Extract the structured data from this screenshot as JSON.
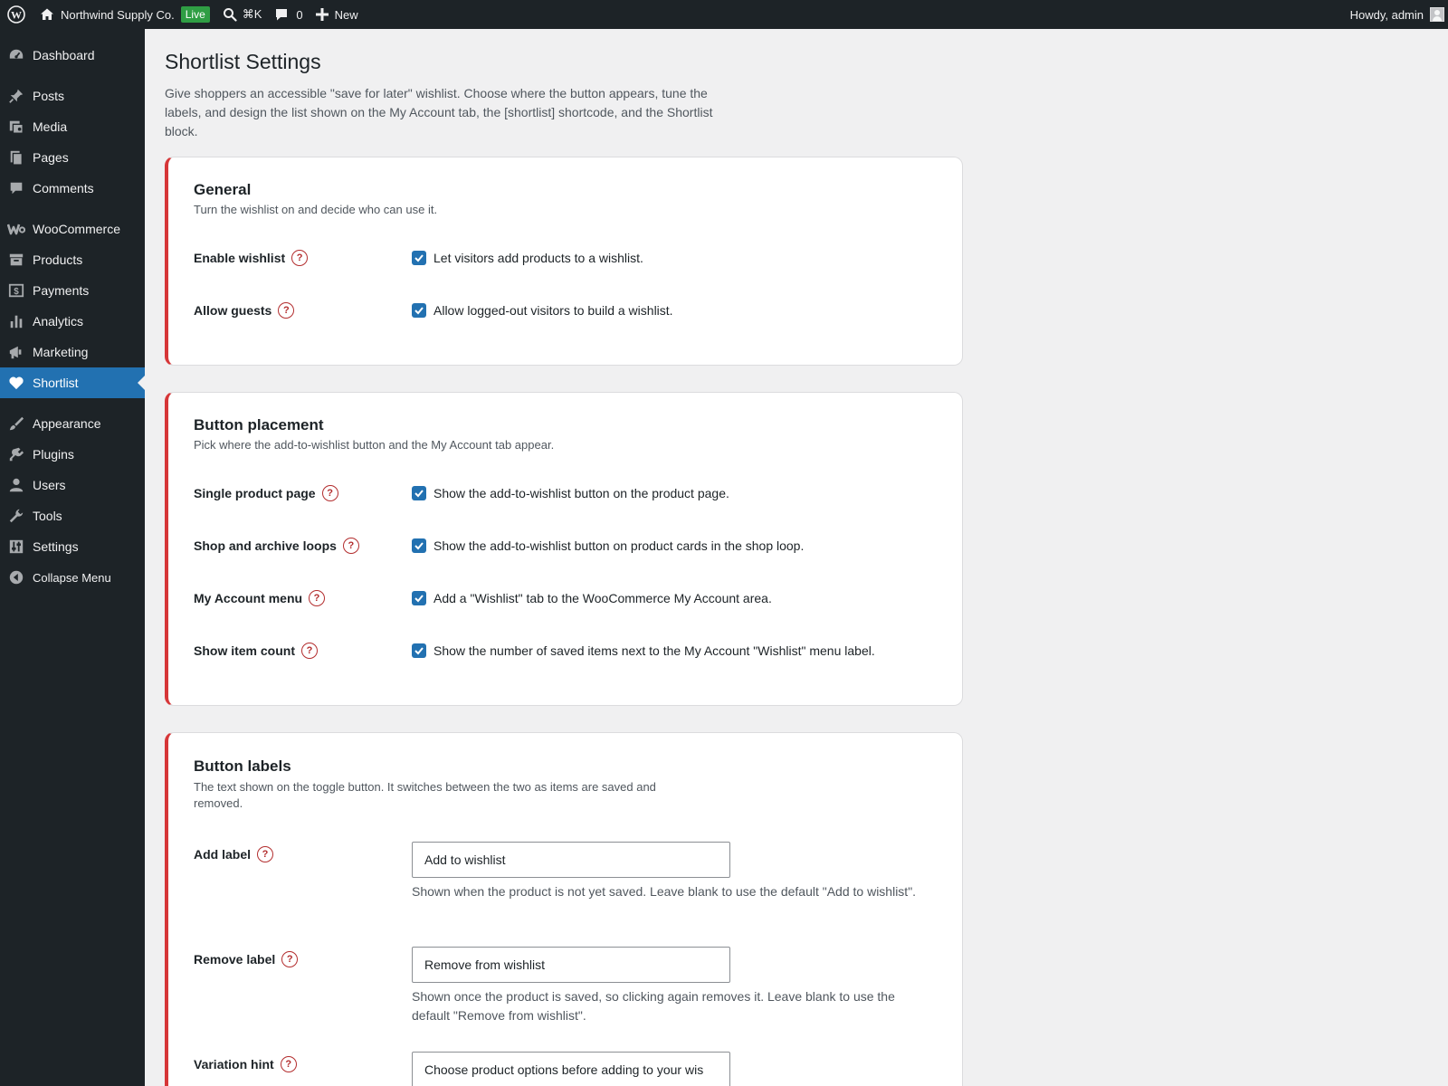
{
  "adminbar": {
    "site_name": "Northwind Supply Co.",
    "live_badge": "Live",
    "search_shortcut": "⌘K",
    "comments_count": "0",
    "new_label": "New",
    "howdy": "Howdy, admin"
  },
  "sidebar": {
    "items": [
      {
        "label": "Dashboard",
        "icon": "dashboard-icon"
      },
      {
        "label": "Posts",
        "icon": "pin-icon"
      },
      {
        "label": "Media",
        "icon": "media-icon"
      },
      {
        "label": "Pages",
        "icon": "pages-icon"
      },
      {
        "label": "Comments",
        "icon": "comment-icon"
      },
      {
        "label": "WooCommerce",
        "icon": "woo-icon"
      },
      {
        "label": "Products",
        "icon": "archive-icon"
      },
      {
        "label": "Payments",
        "icon": "dollar-icon"
      },
      {
        "label": "Analytics",
        "icon": "chart-bar-icon"
      },
      {
        "label": "Marketing",
        "icon": "megaphone-icon"
      },
      {
        "label": "Shortlist",
        "icon": "heart-icon",
        "current": true
      },
      {
        "label": "Appearance",
        "icon": "brush-icon"
      },
      {
        "label": "Plugins",
        "icon": "plug-icon"
      },
      {
        "label": "Users",
        "icon": "user-icon"
      },
      {
        "label": "Tools",
        "icon": "wrench-icon"
      },
      {
        "label": "Settings",
        "icon": "sliders-icon"
      },
      {
        "label": "Collapse Menu",
        "icon": "collapse-icon"
      }
    ]
  },
  "page": {
    "title": "Shortlist Settings",
    "intro": "Give shoppers an accessible \"save for later\" wishlist. Choose where the button appears, tune the labels, and design the list shown on the My Account tab, the [shortlist] shortcode, and the Shortlist block."
  },
  "general": {
    "title": "General",
    "desc": "Turn the wishlist on and decide who can use it.",
    "rows": [
      {
        "label": "Enable wishlist",
        "text": "Let visitors add products to a wishlist.",
        "checked": true
      },
      {
        "label": "Allow guests",
        "text": "Allow logged-out visitors to build a wishlist.",
        "checked": true
      }
    ]
  },
  "placement": {
    "title": "Button placement",
    "desc": "Pick where the add-to-wishlist button and the My Account tab appear.",
    "rows": [
      {
        "label": "Single product page",
        "text": "Show the add-to-wishlist button on the product page.",
        "checked": true
      },
      {
        "label": "Shop and archive loops",
        "text": "Show the add-to-wishlist button on product cards in the shop loop.",
        "checked": true
      },
      {
        "label": "My Account menu",
        "text": "Add a \"Wishlist\" tab to the WooCommerce My Account area.",
        "checked": true
      },
      {
        "label": "Show item count",
        "text": "Show the number of saved items next to the My Account \"Wishlist\" menu label.",
        "checked": true
      }
    ]
  },
  "labels": {
    "title": "Button labels",
    "desc": "The text shown on the toggle button. It switches between the two as items are saved and removed.",
    "add": {
      "label": "Add label",
      "value": "Add to wishlist",
      "desc": "Shown when the product is not yet saved. Leave blank to use the default \"Add to wishlist\"."
    },
    "remove": {
      "label": "Remove label",
      "value": "Remove from wishlist",
      "desc": "Shown once the product is saved, so clicking again removes it. Leave blank to use the default \"Remove from wishlist\"."
    },
    "variation": {
      "label": "Variation hint",
      "value": "Choose product options before adding to your wis"
    }
  }
}
